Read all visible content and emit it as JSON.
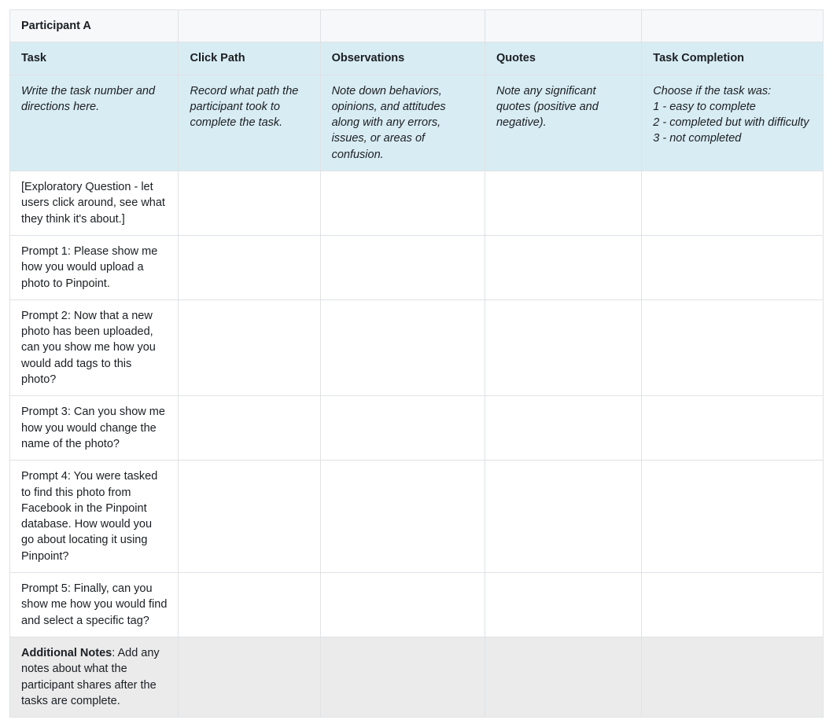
{
  "participant": "Participant A",
  "headers": {
    "task": "Task",
    "clickPath": "Click Path",
    "observations": "Observations",
    "quotes": "Quotes",
    "completion": "Task Completion"
  },
  "descriptions": {
    "task": "Write the task number and directions here.",
    "clickPath": "Record what path the participant took to complete the task.",
    "observations": "Note down behaviors, opinions, and attitudes along with any errors, issues, or areas of confusion.",
    "quotes": "Note any significant quotes (positive and negative).",
    "completionIntro": "Choose if the task was:",
    "completion1": "1 - easy to complete",
    "completion2": "2 - completed but with difficulty",
    "completion3": "3 - not completed"
  },
  "tasks": [
    "[Exploratory Question - let users click around, see what they think it's about.]",
    "Prompt 1: Please show me how you would upload a photo to Pinpoint.",
    "Prompt 2: Now that a new photo has been uploaded, can you show me how you would add tags to this photo?",
    "Prompt 3: Can you show me how you would change the name of the photo?",
    "Prompt 4: You were tasked to find this photo from Facebook in the Pinpoint database. How would you go about locating it using Pinpoint?",
    "Prompt 5: Finally, can you show me how you would find and select a specific tag?"
  ],
  "footer": {
    "label": "Additional Notes",
    "text": ": Add any notes about what the participant shares after the tasks are complete."
  }
}
